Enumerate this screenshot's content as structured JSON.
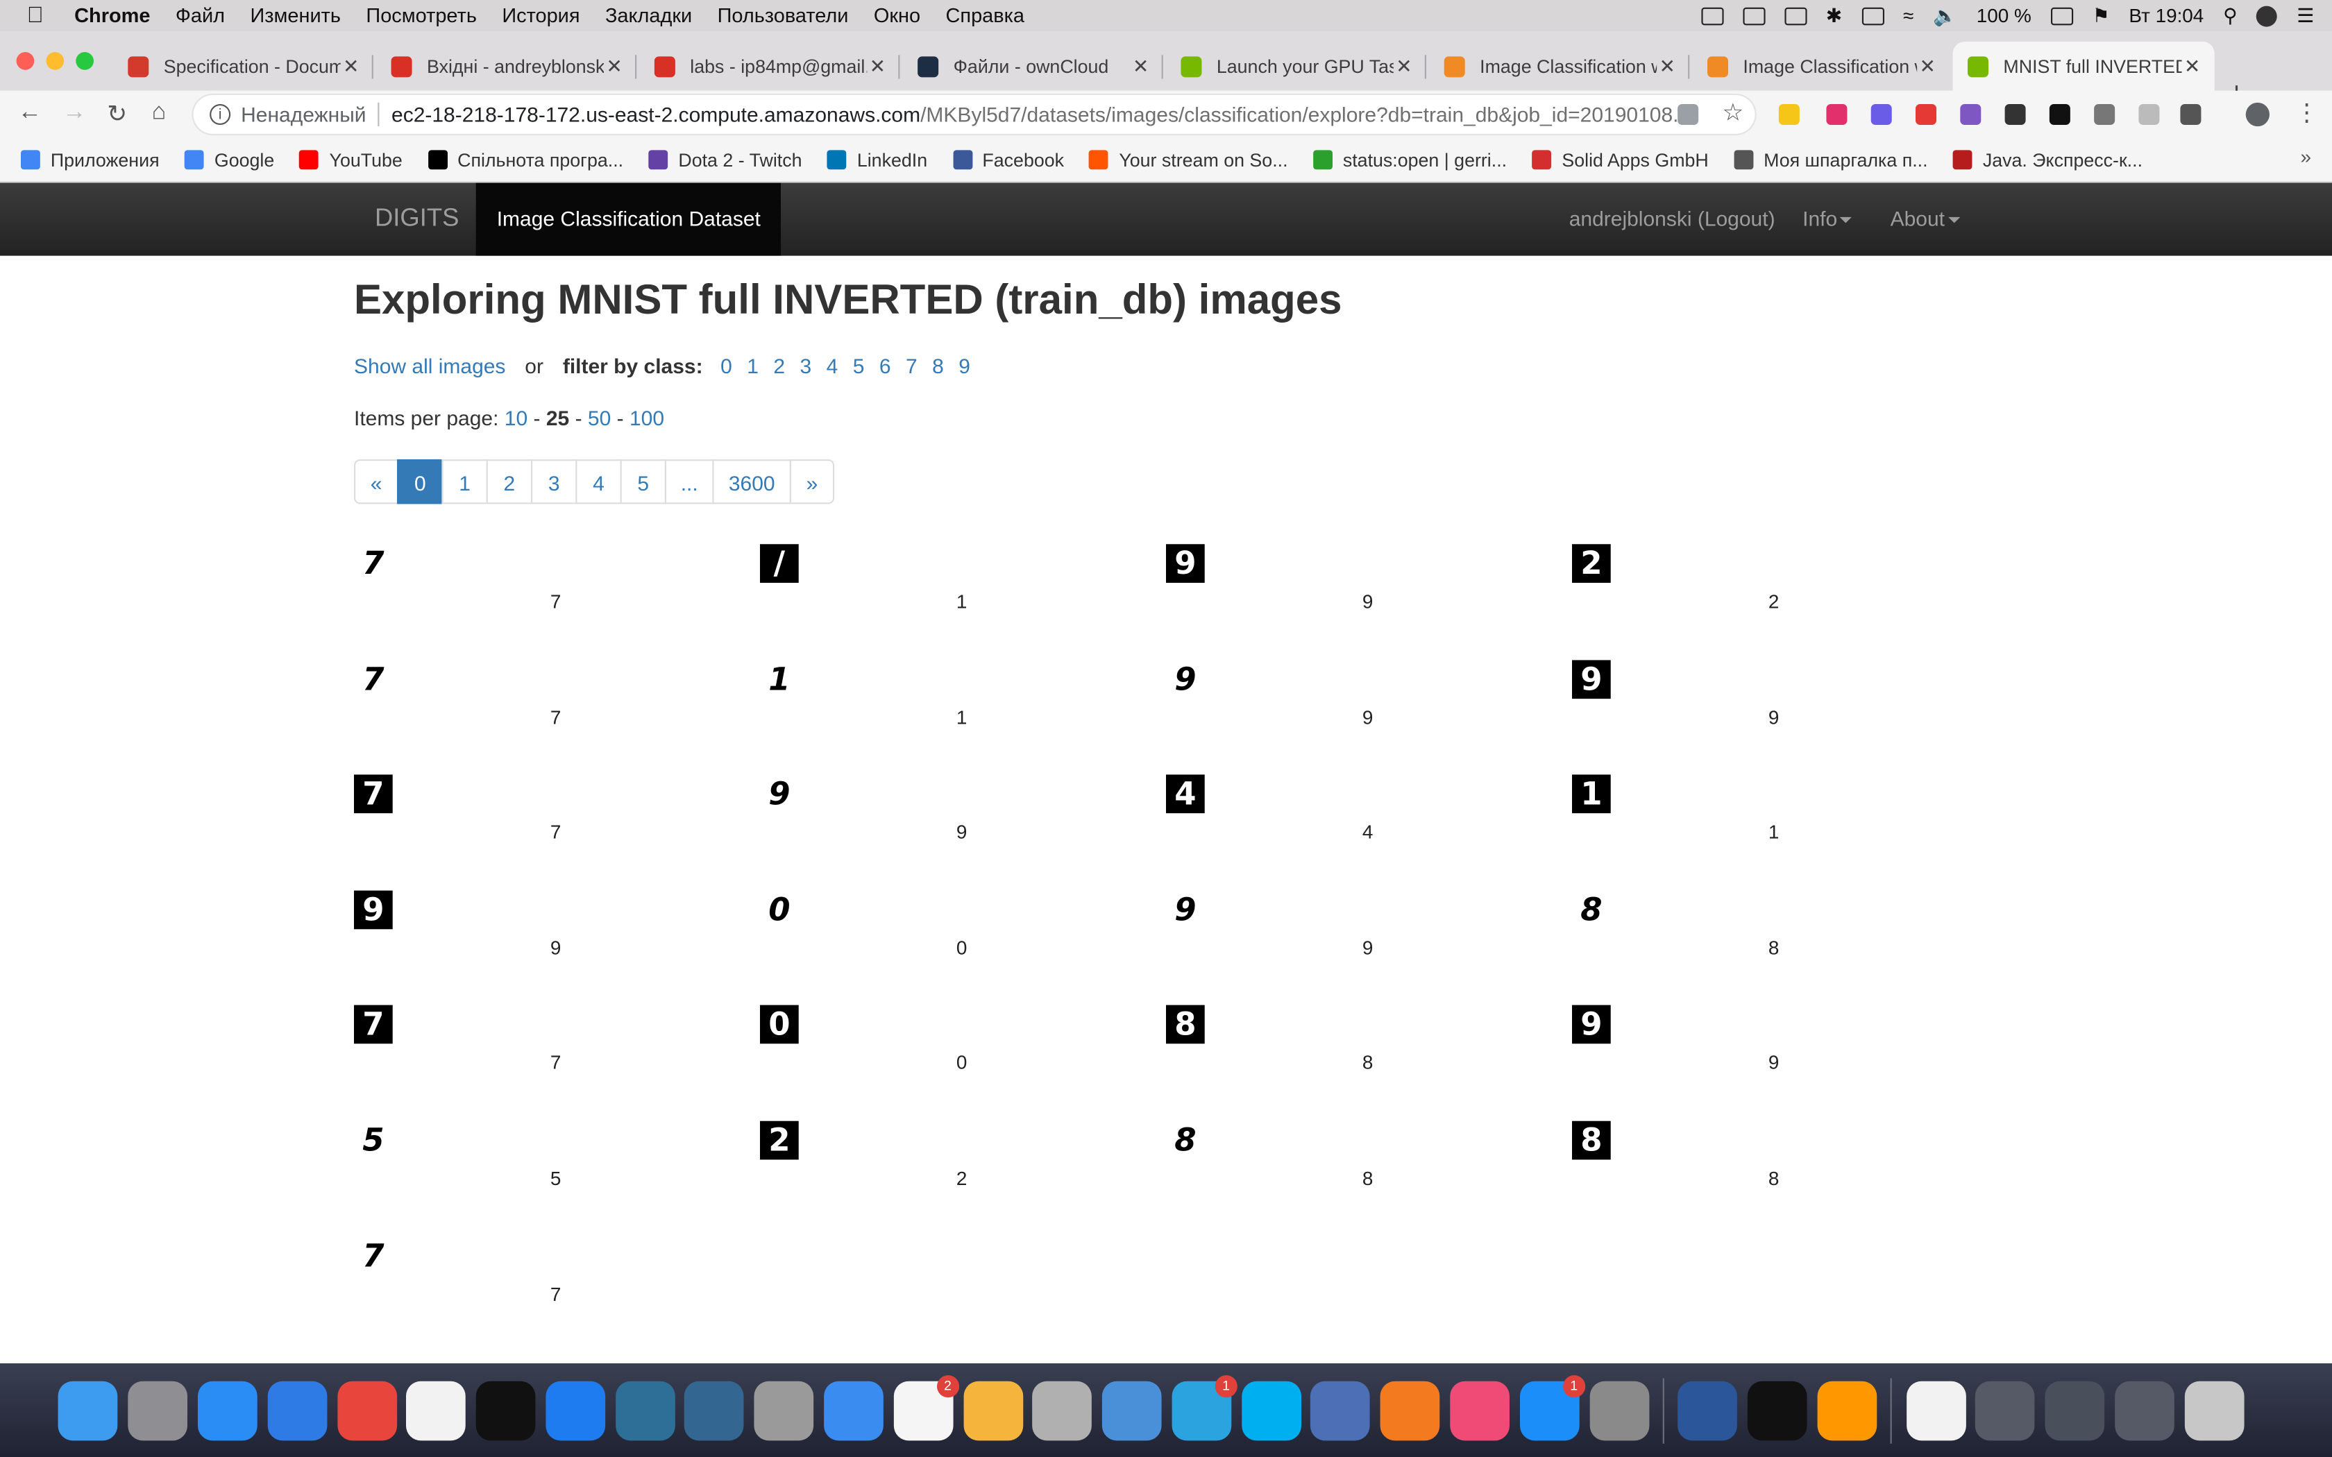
{
  "menubar": {
    "app": "Chrome",
    "items": [
      "Файл",
      "Изменить",
      "Посмотреть",
      "История",
      "Закладки",
      "Пользователи",
      "Окно",
      "Справка"
    ],
    "battery": "100 %",
    "clock": "Вт 19:04"
  },
  "tabs": [
    {
      "title": "Specification - Docum",
      "color": "#d33a2c"
    },
    {
      "title": "Вхідні - andreyblonski",
      "color": "#d93025"
    },
    {
      "title": "labs - ip84mp@gmail.c",
      "color": "#d93025"
    },
    {
      "title": "Файли - ownCloud",
      "color": "#1d2d44"
    },
    {
      "title": "Launch your GPU Task",
      "color": "#76b900"
    },
    {
      "title": "Image Classification w",
      "color": "#f08a24"
    },
    {
      "title": "Image Classification w",
      "color": "#f08a24"
    },
    {
      "title": "MNIST full INVERTED",
      "color": "#76b900"
    }
  ],
  "address": {
    "security": "Ненадежный",
    "host": "ec2-18-218-178-172.us-east-2.compute.amazonaws.com",
    "path": "/MKByl5d7/datasets/images/classification/explore?db=train_db&job_id=20190108..."
  },
  "bookmarks": [
    {
      "label": "Приложения",
      "color": "#4285f4"
    },
    {
      "label": "Google",
      "color": "#4285f4"
    },
    {
      "label": "YouTube",
      "color": "#ff0000"
    },
    {
      "label": "Спільнота програ...",
      "color": "#000000"
    },
    {
      "label": "Dota 2 - Twitch",
      "color": "#6441a5"
    },
    {
      "label": "LinkedIn",
      "color": "#0077b5"
    },
    {
      "label": "Facebook",
      "color": "#3b5998"
    },
    {
      "label": "Your stream on So...",
      "color": "#ff5500"
    },
    {
      "label": "status:open | gerri...",
      "color": "#2ca02c"
    },
    {
      "label": "Solid Apps GmbH",
      "color": "#d32f2f"
    },
    {
      "label": "Моя шпаргалка п...",
      "color": "#555555"
    },
    {
      "label": "Java. Экспресс-к...",
      "color": "#b71c1c"
    }
  ],
  "navbar": {
    "brand": "DIGITS",
    "active": "Image Classification Dataset",
    "user": "andrejblonski (Logout)",
    "info": "Info",
    "about": "About"
  },
  "page": {
    "title": "Exploring MNIST full INVERTED (train_db) images",
    "show_all": "Show all images",
    "or": "or",
    "filter_label": "filter by class:",
    "classes": [
      "0",
      "1",
      "2",
      "3",
      "4",
      "5",
      "6",
      "7",
      "8",
      "9"
    ],
    "items_per_page_label": "Items per page:",
    "per_page_options": [
      "10",
      "25",
      "50",
      "100"
    ],
    "per_page_selected": "25",
    "pagination": [
      "«",
      "0",
      "1",
      "2",
      "3",
      "4",
      "5",
      "...",
      "3600",
      "»"
    ],
    "current_page": "0"
  },
  "images": [
    {
      "digit": "7",
      "label": "7",
      "inverted": false
    },
    {
      "digit": "/",
      "label": "1",
      "inverted": true
    },
    {
      "digit": "9",
      "label": "9",
      "inverted": true
    },
    {
      "digit": "2",
      "label": "2",
      "inverted": true
    },
    {
      "digit": "7",
      "label": "7",
      "inverted": false
    },
    {
      "digit": "1",
      "label": "1",
      "inverted": false
    },
    {
      "digit": "9",
      "label": "9",
      "inverted": false
    },
    {
      "digit": "9",
      "label": "9",
      "inverted": true
    },
    {
      "digit": "7",
      "label": "7",
      "inverted": true
    },
    {
      "digit": "9",
      "label": "9",
      "inverted": false
    },
    {
      "digit": "4",
      "label": "4",
      "inverted": true
    },
    {
      "digit": "1",
      "label": "1",
      "inverted": true
    },
    {
      "digit": "9",
      "label": "9",
      "inverted": true
    },
    {
      "digit": "0",
      "label": "0",
      "inverted": false
    },
    {
      "digit": "9",
      "label": "9",
      "inverted": false
    },
    {
      "digit": "8",
      "label": "8",
      "inverted": false
    },
    {
      "digit": "7",
      "label": "7",
      "inverted": true
    },
    {
      "digit": "0",
      "label": "0",
      "inverted": true
    },
    {
      "digit": "8",
      "label": "8",
      "inverted": true
    },
    {
      "digit": "9",
      "label": "9",
      "inverted": true
    },
    {
      "digit": "5",
      "label": "5",
      "inverted": false
    },
    {
      "digit": "2",
      "label": "2",
      "inverted": true
    },
    {
      "digit": "8",
      "label": "8",
      "inverted": false
    },
    {
      "digit": "8",
      "label": "8",
      "inverted": true
    },
    {
      "digit": "7",
      "label": "7",
      "inverted": false
    }
  ],
  "dock": [
    {
      "name": "finder-icon",
      "color": "#3d9bf0"
    },
    {
      "name": "launchpad-icon",
      "color": "#8e8e93"
    },
    {
      "name": "safari-icon",
      "color": "#2a8df5"
    },
    {
      "name": "spark-icon",
      "color": "#2f7be5"
    },
    {
      "name": "chrome-icon",
      "color": "#e8453c"
    },
    {
      "name": "calendar-icon",
      "color": "#f2f2f2"
    },
    {
      "name": "intellij-icon",
      "color": "#111111"
    },
    {
      "name": "xcode-icon",
      "color": "#1f7cf0"
    },
    {
      "name": "mysql-workbench-icon",
      "color": "#2d6f97"
    },
    {
      "name": "postgres-icon",
      "color": "#336791"
    },
    {
      "name": "database-icon",
      "color": "#9a9a9a"
    },
    {
      "name": "simplenote-icon",
      "color": "#3b8cf0"
    },
    {
      "name": "reminders-icon",
      "color": "#f5f5f5",
      "badge": "2"
    },
    {
      "name": "photos-icon",
      "color": "#f5b43b"
    },
    {
      "name": "calculator-icon",
      "color": "#b0b0b0"
    },
    {
      "name": "preview-icon",
      "color": "#4a90d9"
    },
    {
      "name": "telegram-icon",
      "color": "#2aa3df",
      "badge": "1"
    },
    {
      "name": "skype-icon",
      "color": "#00aff0"
    },
    {
      "name": "archiver-icon",
      "color": "#4c6fb5"
    },
    {
      "name": "hype-icon",
      "color": "#f47a20"
    },
    {
      "name": "itunes-icon",
      "color": "#f04a76"
    },
    {
      "name": "app-store-icon",
      "color": "#1c8ef9",
      "badge": "1"
    },
    {
      "name": "system-preferences-icon",
      "color": "#8a8a8a"
    },
    {
      "name": "word-icon",
      "color": "#2b579a"
    },
    {
      "name": "terminal-icon",
      "color": "#111111"
    },
    {
      "name": "sublime-icon",
      "color": "#ff9800"
    },
    {
      "name": "document-icon",
      "color": "#f2f2f2"
    },
    {
      "name": "window-thumb-icon",
      "color": "#555a66"
    },
    {
      "name": "window-thumb-2-icon",
      "color": "#4a4f5c"
    },
    {
      "name": "window-thumb-3-icon",
      "color": "#555a66"
    },
    {
      "name": "trash-icon",
      "color": "#c7c7c7"
    }
  ]
}
